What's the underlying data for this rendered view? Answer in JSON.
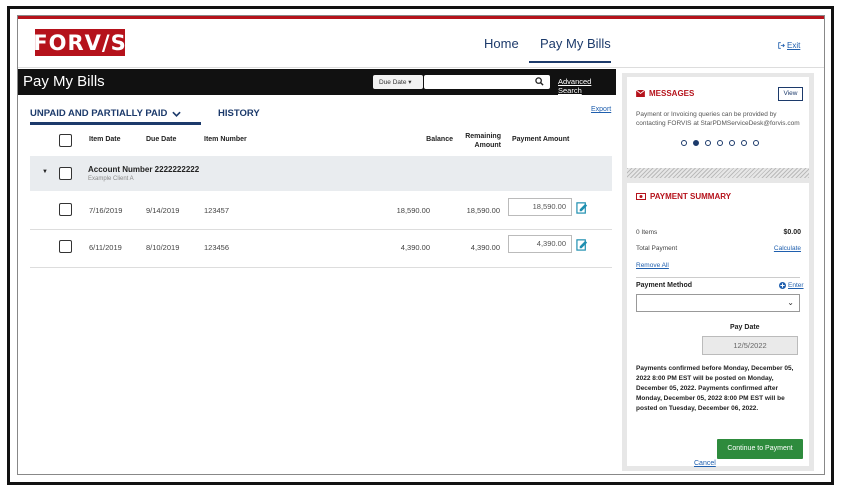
{
  "header": {
    "logo_text": "FORV/S",
    "nav": [
      {
        "label": "Home"
      },
      {
        "label": "Pay My Bills"
      }
    ],
    "exit_label": "Exit"
  },
  "toolbar": {
    "page_title": "Pay My Bills",
    "sort_select": "Due Date ▾",
    "search_value": "",
    "advanced_search": "Advanced Search"
  },
  "tabs": {
    "unpaid": "UNPAID AND PARTIALLY PAID",
    "history": "HISTORY",
    "export": "Export"
  },
  "table": {
    "columns": {
      "item_date": "Item Date",
      "due_date": "Due Date",
      "item_number": "Item Number",
      "balance": "Balance",
      "remaining_1": "Remaining",
      "remaining_2": "Amount",
      "payment_amount": "Payment Amount"
    },
    "account": {
      "number": "Account Number 2222222222",
      "client": "Example Client A"
    },
    "rows": [
      {
        "item_date": "7/16/2019",
        "due_date": "9/14/2019",
        "item_number": "123457",
        "balance": "18,590.00",
        "remaining": "18,590.00",
        "payment": "18,590.00"
      },
      {
        "item_date": "6/11/2019",
        "due_date": "8/10/2019",
        "item_number": "123456",
        "balance": "4,390.00",
        "remaining": "4,390.00",
        "payment": "4,390.00"
      }
    ]
  },
  "messages": {
    "title": "MESSAGES",
    "view_button": "View",
    "body": "Payment or Invoicing queries can be provided by contacting FORVIS at StarPDMServiceDesk@forvis.com"
  },
  "payment_summary": {
    "title": "PAYMENT SUMMARY",
    "items_label": "0 Items",
    "items_total": "$0.00",
    "total_payment_label": "Total Payment",
    "calculate": "Calculate",
    "remove_all": "Remove All",
    "method_label": "Payment Method",
    "enter": "Enter",
    "method_value": "",
    "pay_date_label": "Pay Date",
    "pay_date_value": "12/5/2022",
    "notice": "Payments confirmed before Monday, December 05, 2022 8:00 PM EST will be posted on Monday, December 05, 2022. Payments confirmed after Monday, December 05, 2022 8:00 PM EST will be posted on Tuesday, December 06, 2022.",
    "cancel": "Cancel",
    "continue": "Continue to Payment"
  },
  "colors": {
    "brand_red": "#b5121b",
    "navy": "#1c3a6b",
    "link_blue": "#1f5fae",
    "continue_green": "#2e8b3d"
  }
}
